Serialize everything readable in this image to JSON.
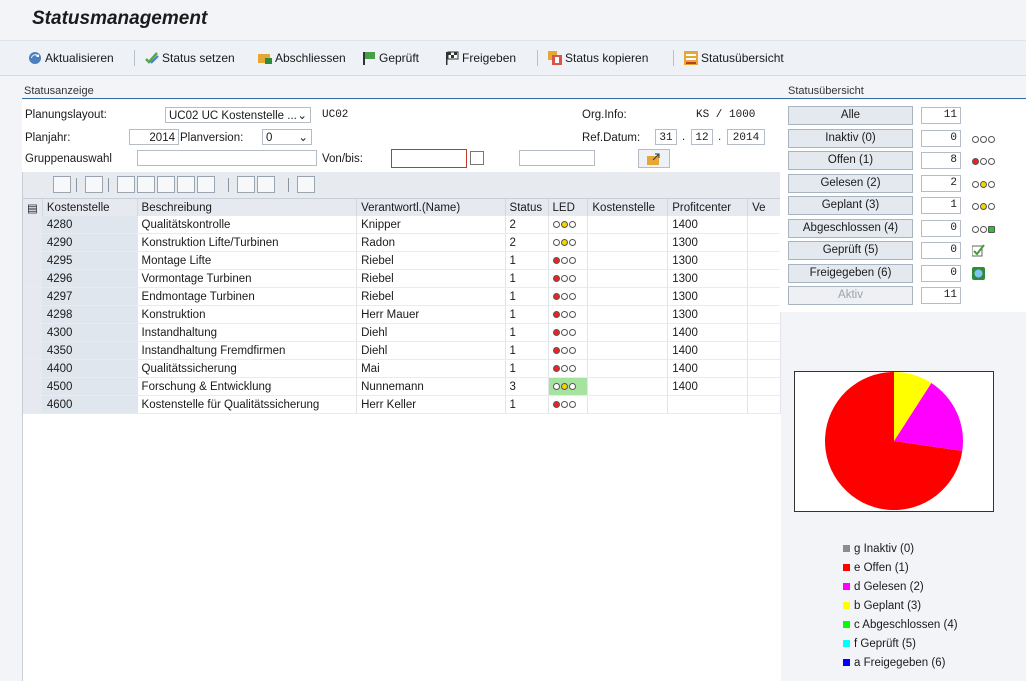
{
  "title": "Statusmanagement",
  "toolbar": {
    "refresh": "Aktualisieren",
    "set_status": "Status setzen",
    "close": "Abschliessen",
    "checked": "Geprüft",
    "release": "Freigeben",
    "copy_status": "Status kopieren",
    "overview": "Statusübersicht"
  },
  "status_panel": {
    "header": "Statusanzeige",
    "planning_layout_label": "Planungslayout:",
    "planning_layout_value": "UC02 UC Kostenstelle ...",
    "planning_layout_code": "UC02",
    "org_info_label": "Org.Info:",
    "org_info_value": "KS / 1000",
    "plan_year_label": "Planjahr:",
    "plan_year_value": "2014",
    "plan_version_label": "Planversion:",
    "plan_version_value": "0",
    "ref_date_label": "Ref.Datum:",
    "ref_date_day": "31",
    "ref_date_dot1": ".",
    "ref_date_month": "12",
    "ref_date_dot2": ".",
    "ref_date_year": "2014",
    "group_label": "Gruppenauswahl",
    "from_to_label": "Von/bis:"
  },
  "grid": {
    "columns": [
      "Kostenstelle",
      "Beschreibung",
      "Verantwortl.(Name)",
      "Status",
      "LED",
      "Kostenstelle",
      "Profitcenter",
      "Ve"
    ],
    "rows": [
      {
        "kst": "4280",
        "desc": "Qualitätskontrolle",
        "name": "Knipper",
        "status": "2",
        "led": "yellow",
        "pc": "1400"
      },
      {
        "kst": "4290",
        "desc": "Konstruktion Lifte/Turbinen",
        "name": "Radon",
        "status": "2",
        "led": "yellow",
        "pc": "1300"
      },
      {
        "kst": "4295",
        "desc": "Montage Lifte",
        "name": "Riebel",
        "status": "1",
        "led": "red",
        "pc": "1300"
      },
      {
        "kst": "4296",
        "desc": "Vormontage Turbinen",
        "name": "Riebel",
        "status": "1",
        "led": "red",
        "pc": "1300"
      },
      {
        "kst": "4297",
        "desc": "Endmontage Turbinen",
        "name": "Riebel",
        "status": "1",
        "led": "red",
        "pc": "1300"
      },
      {
        "kst": "4298",
        "desc": "Konstruktion",
        "name": "Herr Mauer",
        "status": "1",
        "led": "red",
        "pc": "1300"
      },
      {
        "kst": "4300",
        "desc": "Instandhaltung",
        "name": "Diehl",
        "status": "1",
        "led": "red",
        "pc": "1400"
      },
      {
        "kst": "4350",
        "desc": "Instandhaltung Fremdfirmen",
        "name": "Diehl",
        "status": "1",
        "led": "red",
        "pc": "1400"
      },
      {
        "kst": "4400",
        "desc": "Qualitätssicherung",
        "name": "Mai",
        "status": "1",
        "led": "red",
        "pc": "1400"
      },
      {
        "kst": "4500",
        "desc": "Forschung & Entwicklung",
        "name": "Nunnemann",
        "status": "3",
        "led": "yellow-green",
        "pc": "1400"
      },
      {
        "kst": "4600",
        "desc": "Kostenstelle für Qualitätssicherung",
        "name": "Herr Keller",
        "status": "1",
        "led": "red",
        "pc": ""
      }
    ]
  },
  "overview": {
    "header": "Statusübersicht",
    "buttons": [
      {
        "label": "Alle",
        "count": "11",
        "icon": "none"
      },
      {
        "label": "Inaktiv (0)",
        "count": "0",
        "icon": "led-off"
      },
      {
        "label": "Offen (1)",
        "count": "8",
        "icon": "led-red"
      },
      {
        "label": "Gelesen (2)",
        "count": "2",
        "icon": "led-yellow"
      },
      {
        "label": "Geplant (3)",
        "count": "1",
        "icon": "led-yellow"
      },
      {
        "label": "Abgeschlossen (4)",
        "count": "0",
        "icon": "led-green"
      },
      {
        "label": "Geprüft (5)",
        "count": "0",
        "icon": "check-icon"
      },
      {
        "label": "Freigegeben (6)",
        "count": "0",
        "icon": "release-icon"
      },
      {
        "label": "Aktiv",
        "count": "11",
        "icon": "none"
      }
    ]
  },
  "chart_data": {
    "type": "pie",
    "categories": [
      "g Inaktiv (0)",
      "e Offen (1)",
      "d Gelesen (2)",
      "b Geplant (3)",
      "c Abgeschlossen (4)",
      "f  Geprüft (5)",
      "a Freigegeben (6)"
    ],
    "values": [
      0,
      8,
      2,
      1,
      0,
      0,
      0
    ],
    "colors": [
      "#8c8c8c",
      "#ff0000",
      "#ff00ff",
      "#ffff00",
      "#00ff00",
      "#00ffff",
      "#0000ff"
    ],
    "legend": "below"
  }
}
